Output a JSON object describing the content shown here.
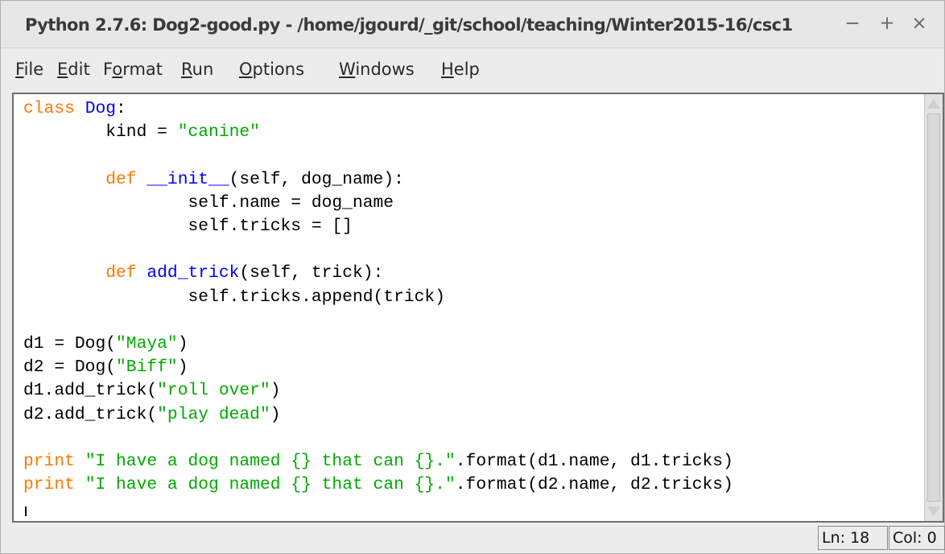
{
  "window": {
    "title": "Python 2.7.6: Dog2-good.py - /home/jgourd/_git/school/teaching/Winter2015-16/csc1",
    "controls": {
      "minimize": "−",
      "maximize": "+",
      "close": "×"
    }
  },
  "menu": {
    "items": [
      {
        "accel": "F",
        "rest": "ile"
      },
      {
        "accel": "E",
        "rest": "dit"
      },
      {
        "pre": "F",
        "accel": "o",
        "rest": "rmat"
      },
      {
        "accel": "R",
        "rest": "un"
      },
      {
        "accel": "O",
        "rest": "ptions"
      },
      {
        "accel": "W",
        "rest": "indows"
      },
      {
        "accel": "H",
        "rest": "elp"
      }
    ]
  },
  "editor": {
    "lines": [
      "class Dog:",
      "        kind = \"canine\"",
      "",
      "        def __init__(self, dog_name):",
      "                self.name = dog_name",
      "                self.tricks = []",
      "",
      "        def add_trick(self, trick):",
      "                self.tricks.append(trick)",
      "",
      "d1 = Dog(\"Maya\")",
      "d2 = Dog(\"Biff\")",
      "d1.add_trick(\"roll over\")",
      "d2.add_trick(\"play dead\")",
      "",
      "print \"I have a dog named {} that can {}.\".format(d1.name, d1.tricks)",
      "print \"I have a dog named {} that can {}.\".format(d2.name, d2.tricks)"
    ]
  },
  "status": {
    "line": "Ln: 18",
    "col": "Col: 0"
  },
  "colors": {
    "keyword": "#ff7700",
    "definition": "#0000ff",
    "string": "#00aa00"
  }
}
